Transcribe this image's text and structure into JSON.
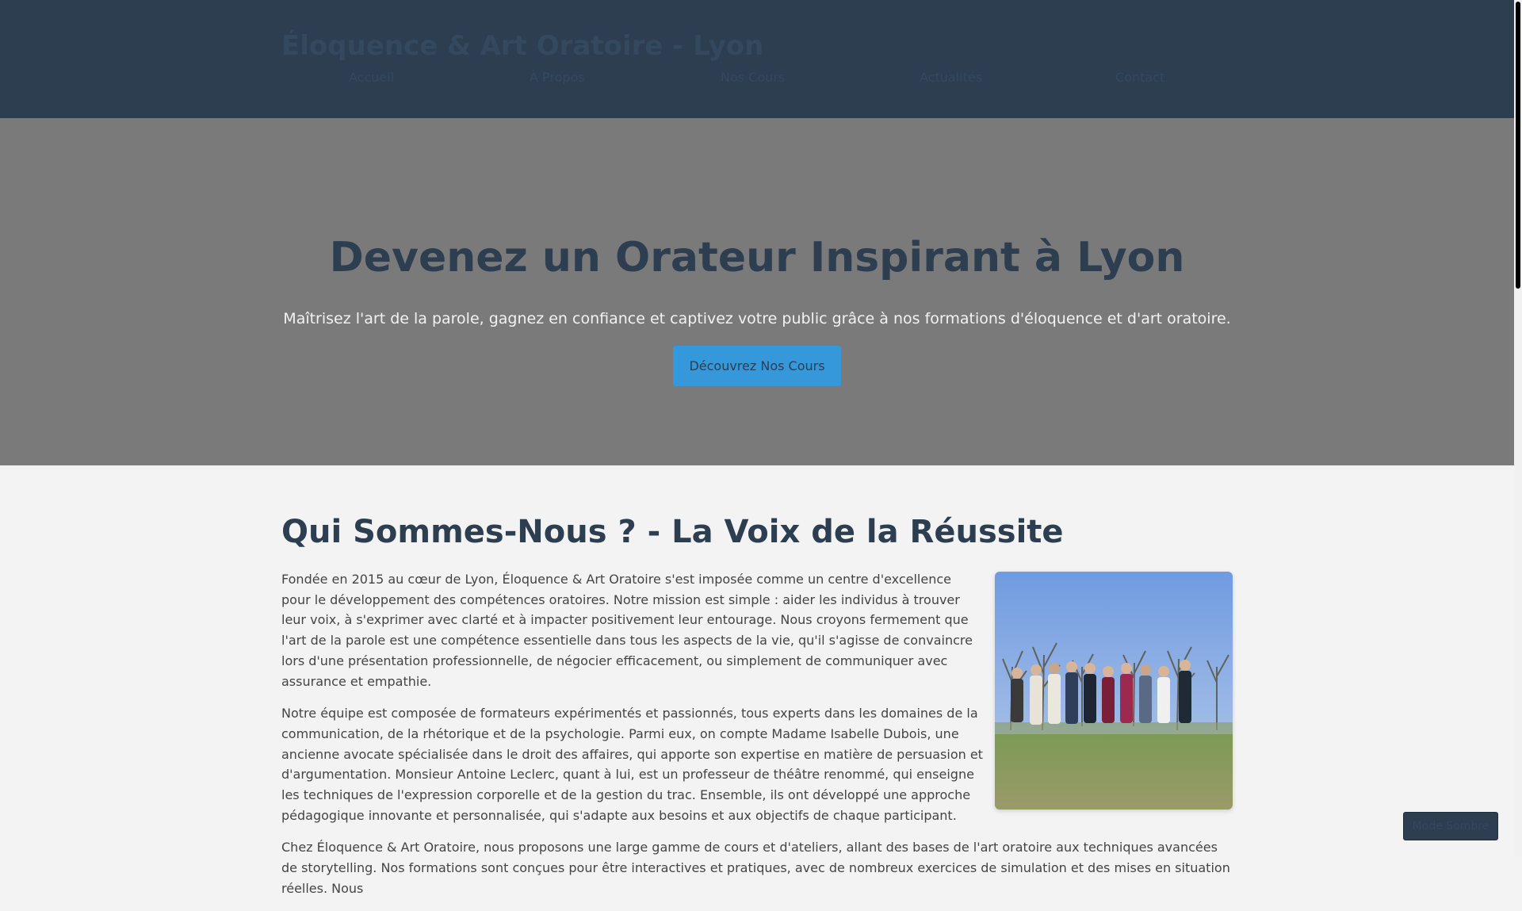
{
  "header": {
    "site_title": "Éloquence & Art Oratoire - Lyon",
    "nav": [
      {
        "label": "Accueil"
      },
      {
        "label": "À Propos"
      },
      {
        "label": "Nos Cours"
      },
      {
        "label": "Actualités"
      },
      {
        "label": "Contact"
      }
    ]
  },
  "hero": {
    "title": "Devenez un Orateur Inspirant à Lyon",
    "subtitle": "Maîtrisez l'art de la parole, gagnez en confiance et captivez votre public grâce à nos formations d'éloquence et d'art oratoire.",
    "cta_label": "Découvrez Nos Cours"
  },
  "about": {
    "title": "Qui Sommes-Nous ? - La Voix de la Réussite",
    "paragraphs": [
      "Fondée en 2015 au cœur de Lyon, Éloquence & Art Oratoire s'est imposée comme un centre d'excellence pour le développement des compétences oratoires. Notre mission est simple : aider les individus à trouver leur voix, à s'exprimer avec clarté et à impacter positivement leur entourage. Nous croyons fermement que l'art de la parole est une compétence essentielle dans tous les aspects de la vie, qu'il s'agisse de convaincre lors d'une présentation professionnelle, de négocier efficacement, ou simplement de communiquer avec assurance et empathie.",
      "Notre équipe est composée de formateurs expérimentés et passionnés, tous experts dans les domaines de la communication, de la rhétorique et de la psychologie. Parmi eux, on compte Madame Isabelle Dubois, une ancienne avocate spécialisée dans le droit des affaires, qui apporte son expertise en matière de persuasion et d'argumentation. Monsieur Antoine Leclerc, quant à lui, est un professeur de théâtre renommé, qui enseigne les techniques de l'expression corporelle et de la gestion du trac. Ensemble, ils ont développé une approche pédagogique innovante et personnalisée, qui s'adapte aux besoins et aux objectifs de chaque participant.",
      "Chez Éloquence & Art Oratoire, nous proposons une large gamme de cours et d'ateliers, allant des bases de l'art oratoire aux techniques avancées de storytelling. Nos formations sont conçues pour être interactives et pratiques, avec de nombreux exercices de simulation et des mises en situation réelles. Nous"
    ]
  },
  "dark_mode": {
    "label": "Mode Sombre"
  },
  "colors": {
    "header_bg": "#2c3e50",
    "hero_bg": "#7a7a7a",
    "accent": "#3498db",
    "page_bg": "#f3f3f3"
  }
}
